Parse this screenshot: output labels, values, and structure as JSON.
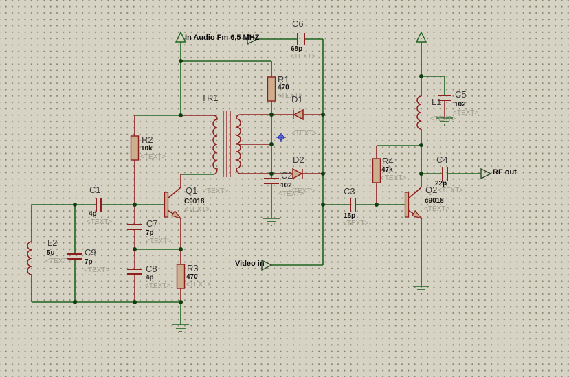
{
  "app": {
    "view": "schematic-canvas"
  },
  "colors": {
    "background": "#d7d3c4",
    "grid_dot": "#84826e",
    "wire_green": "#1e651e",
    "part_red": "#8f1f1f",
    "part_fill": "#ccb08e",
    "junction": "#0f3f0f",
    "origin_marker_blue": "#2233bb",
    "ref_text": "#3b3b3b",
    "value_text": "#141414",
    "placeholder_text": "#9d9b8d"
  },
  "terminals": {
    "audio_in": "In Audio Fm 6,5 MHZ",
    "video_in": "Video in",
    "rf_out": "RF out"
  },
  "components": {
    "c6": {
      "ref": "C6",
      "value": "68p",
      "placeholder": "<TEXT>"
    },
    "r1": {
      "ref": "R1",
      "value": "470",
      "placeholder": "<TEXT>"
    },
    "tr1": {
      "ref": "TR1"
    },
    "d1": {
      "ref": "D1",
      "placeholder": "<TEXT>"
    },
    "d2": {
      "ref": "D2",
      "placeholder": "<TEXT>"
    },
    "c2": {
      "ref": "C2",
      "value": "102",
      "placeholder": "<TEXT>"
    },
    "r2": {
      "ref": "R2",
      "value": "10k",
      "placeholder": "<TEXT>"
    },
    "q1": {
      "ref": "Q1",
      "value": "C9018",
      "placeholder": "<TEXT>",
      "placeholder2": "<TEXT>"
    },
    "c1": {
      "ref": "C1",
      "value": "4p",
      "placeholder": "<TEXT>"
    },
    "c7": {
      "ref": "C7",
      "value": "7p",
      "placeholder": "<TEXT>"
    },
    "c8": {
      "ref": "C8",
      "value": "4p",
      "placeholder": "<TEXT>"
    },
    "c9": {
      "ref": "C9",
      "value": "7p",
      "placeholder": "<TEXT>"
    },
    "l2": {
      "ref": "L2",
      "value": "5u",
      "placeholder": "<TEXT>"
    },
    "r3": {
      "ref": "R3",
      "value": "470",
      "placeholder": "<TEXT>"
    },
    "c3": {
      "ref": "C3",
      "value": "15p",
      "placeholder": "<TEXT>"
    },
    "r4": {
      "ref": "R4",
      "value": "47k",
      "placeholder": "<TEXT>"
    },
    "q2": {
      "ref": "Q2",
      "value": "c9018",
      "placeholder": "<TEXT>",
      "placeholder2": "<TEXT>"
    },
    "c4": {
      "ref": "C4",
      "value": "22p"
    },
    "l1": {
      "ref": "L1",
      "placeholder": "<TEXT>"
    },
    "c5": {
      "ref": "C5",
      "value": "102",
      "placeholder": "<TEXT>"
    }
  }
}
